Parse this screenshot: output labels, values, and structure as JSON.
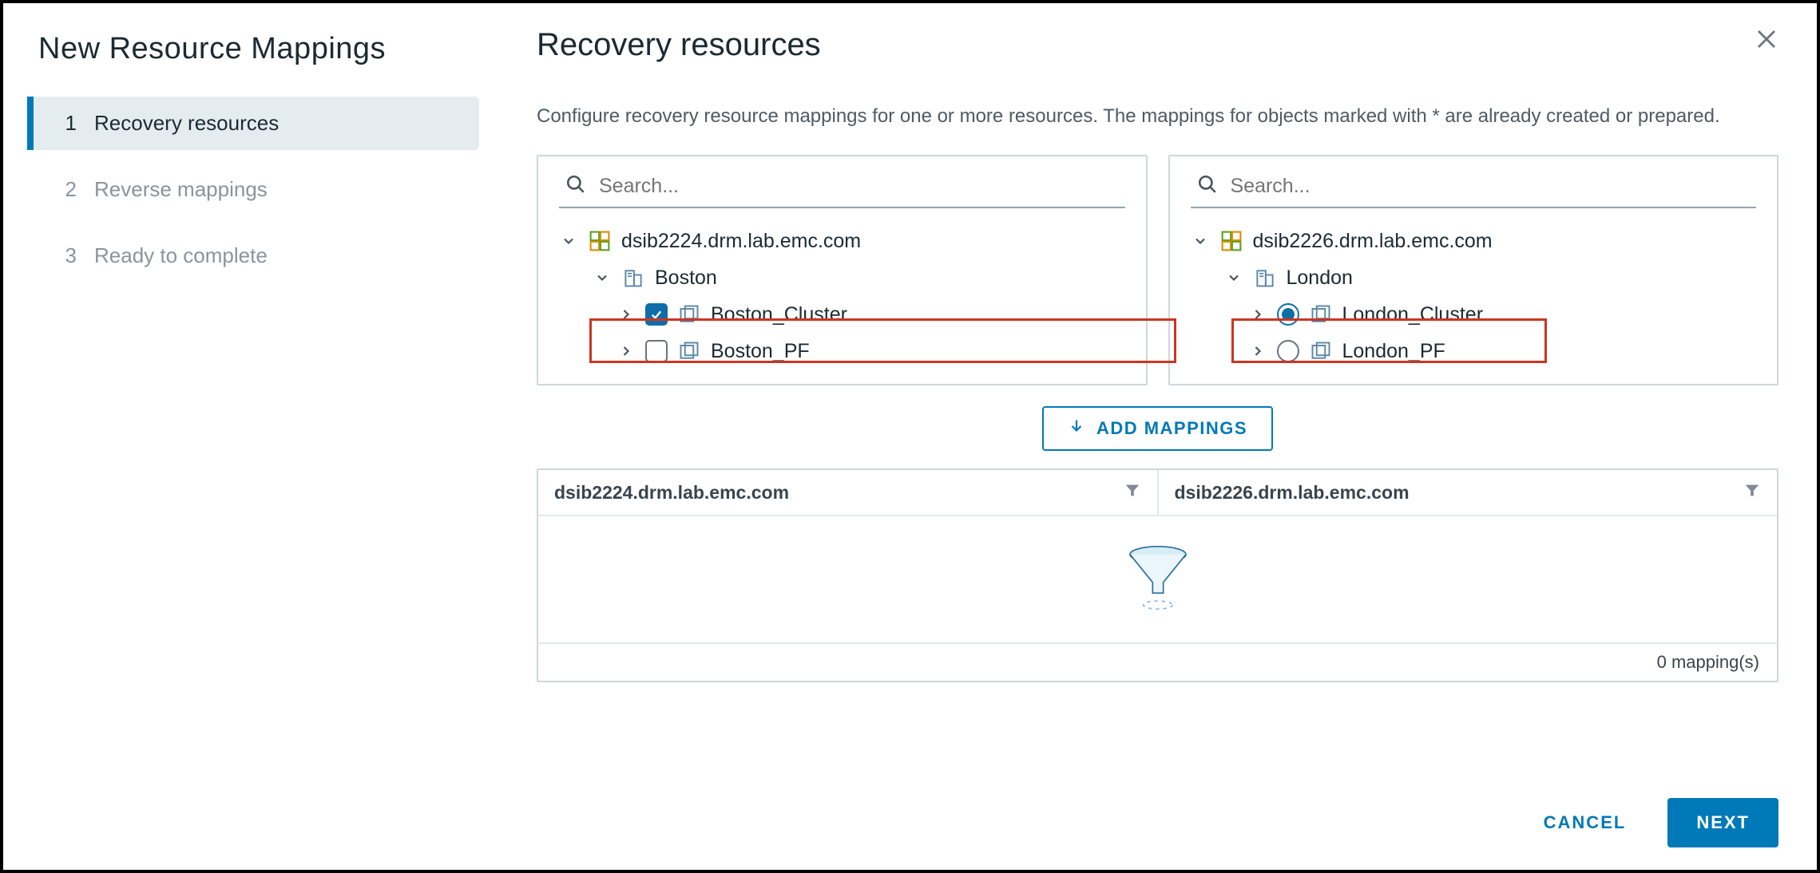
{
  "sidebar": {
    "title": "New Resource Mappings",
    "steps": [
      {
        "num": "1",
        "label": "Recovery resources",
        "active": true
      },
      {
        "num": "2",
        "label": "Reverse mappings",
        "active": false
      },
      {
        "num": "3",
        "label": "Ready to complete",
        "active": false
      }
    ]
  },
  "header": {
    "title": "Recovery resources",
    "description": "Configure recovery resource mappings for one or more resources. The mappings for objects marked with * are already created or prepared."
  },
  "left_panel": {
    "search_placeholder": "Search...",
    "vcenter": "dsib2224.drm.lab.emc.com",
    "datacenter": "Boston",
    "clusters": [
      {
        "name": "Boston_Cluster",
        "checked": true
      },
      {
        "name": "Boston_PF",
        "checked": false
      }
    ]
  },
  "right_panel": {
    "search_placeholder": "Search...",
    "vcenter": "dsib2226.drm.lab.emc.com",
    "datacenter": "London",
    "clusters": [
      {
        "name": "London_Cluster",
        "selected": true
      },
      {
        "name": "London_PF",
        "selected": false
      }
    ]
  },
  "add_button": "ADD MAPPINGS",
  "table": {
    "col_left": "dsib2224.drm.lab.emc.com",
    "col_right": "dsib2226.drm.lab.emc.com",
    "footer": "0 mapping(s)"
  },
  "footer": {
    "cancel": "CANCEL",
    "next": "NEXT"
  }
}
